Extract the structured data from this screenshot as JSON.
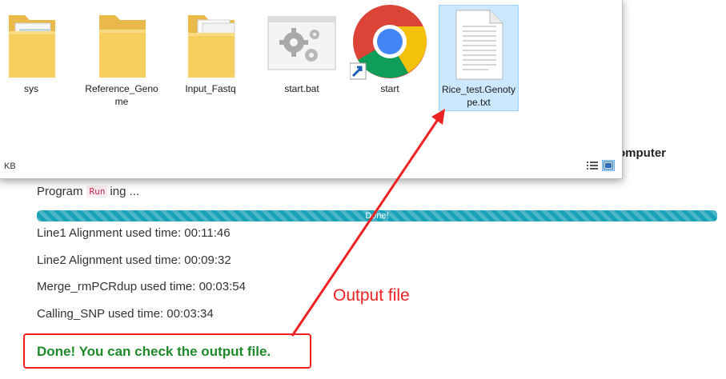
{
  "web": {
    "heading_fragment": "ne computer",
    "program": {
      "prefix": "Program",
      "badge": "Run",
      "suffix": "ing ..."
    },
    "progress": {
      "label": "Done!",
      "percent": 100,
      "color": "#17a2b8"
    },
    "times": [
      "Line1 Alignment used time: 00:11:46",
      "Line2 Alignment used time: 00:09:32",
      "Merge_rmPCRdup used time: 00:03:54",
      "Calling_SNP used time: 00:03:34"
    ],
    "done_message": "Done! You can check the output file.",
    "done_color": "#1e8a2a"
  },
  "explorer": {
    "items": [
      {
        "name": "sys",
        "icon": "folder-icon",
        "selected": false
      },
      {
        "name": "Reference_Genome",
        "icon": "folder-icon",
        "selected": false
      },
      {
        "name": "Input_Fastq",
        "icon": "folder-icon",
        "selected": false
      },
      {
        "name": "start.bat",
        "icon": "batch-file-gears-icon",
        "selected": false
      },
      {
        "name": "start",
        "icon": "chrome-shortcut-icon",
        "selected": false
      },
      {
        "name": "Rice_test.Genotype.txt",
        "icon": "text-file-icon",
        "selected": true
      }
    ],
    "status_size": "KB",
    "views": [
      "details-view-icon",
      "large-icons-view-icon"
    ]
  },
  "annotation": {
    "label": "Output file",
    "color": "#ee2222"
  }
}
